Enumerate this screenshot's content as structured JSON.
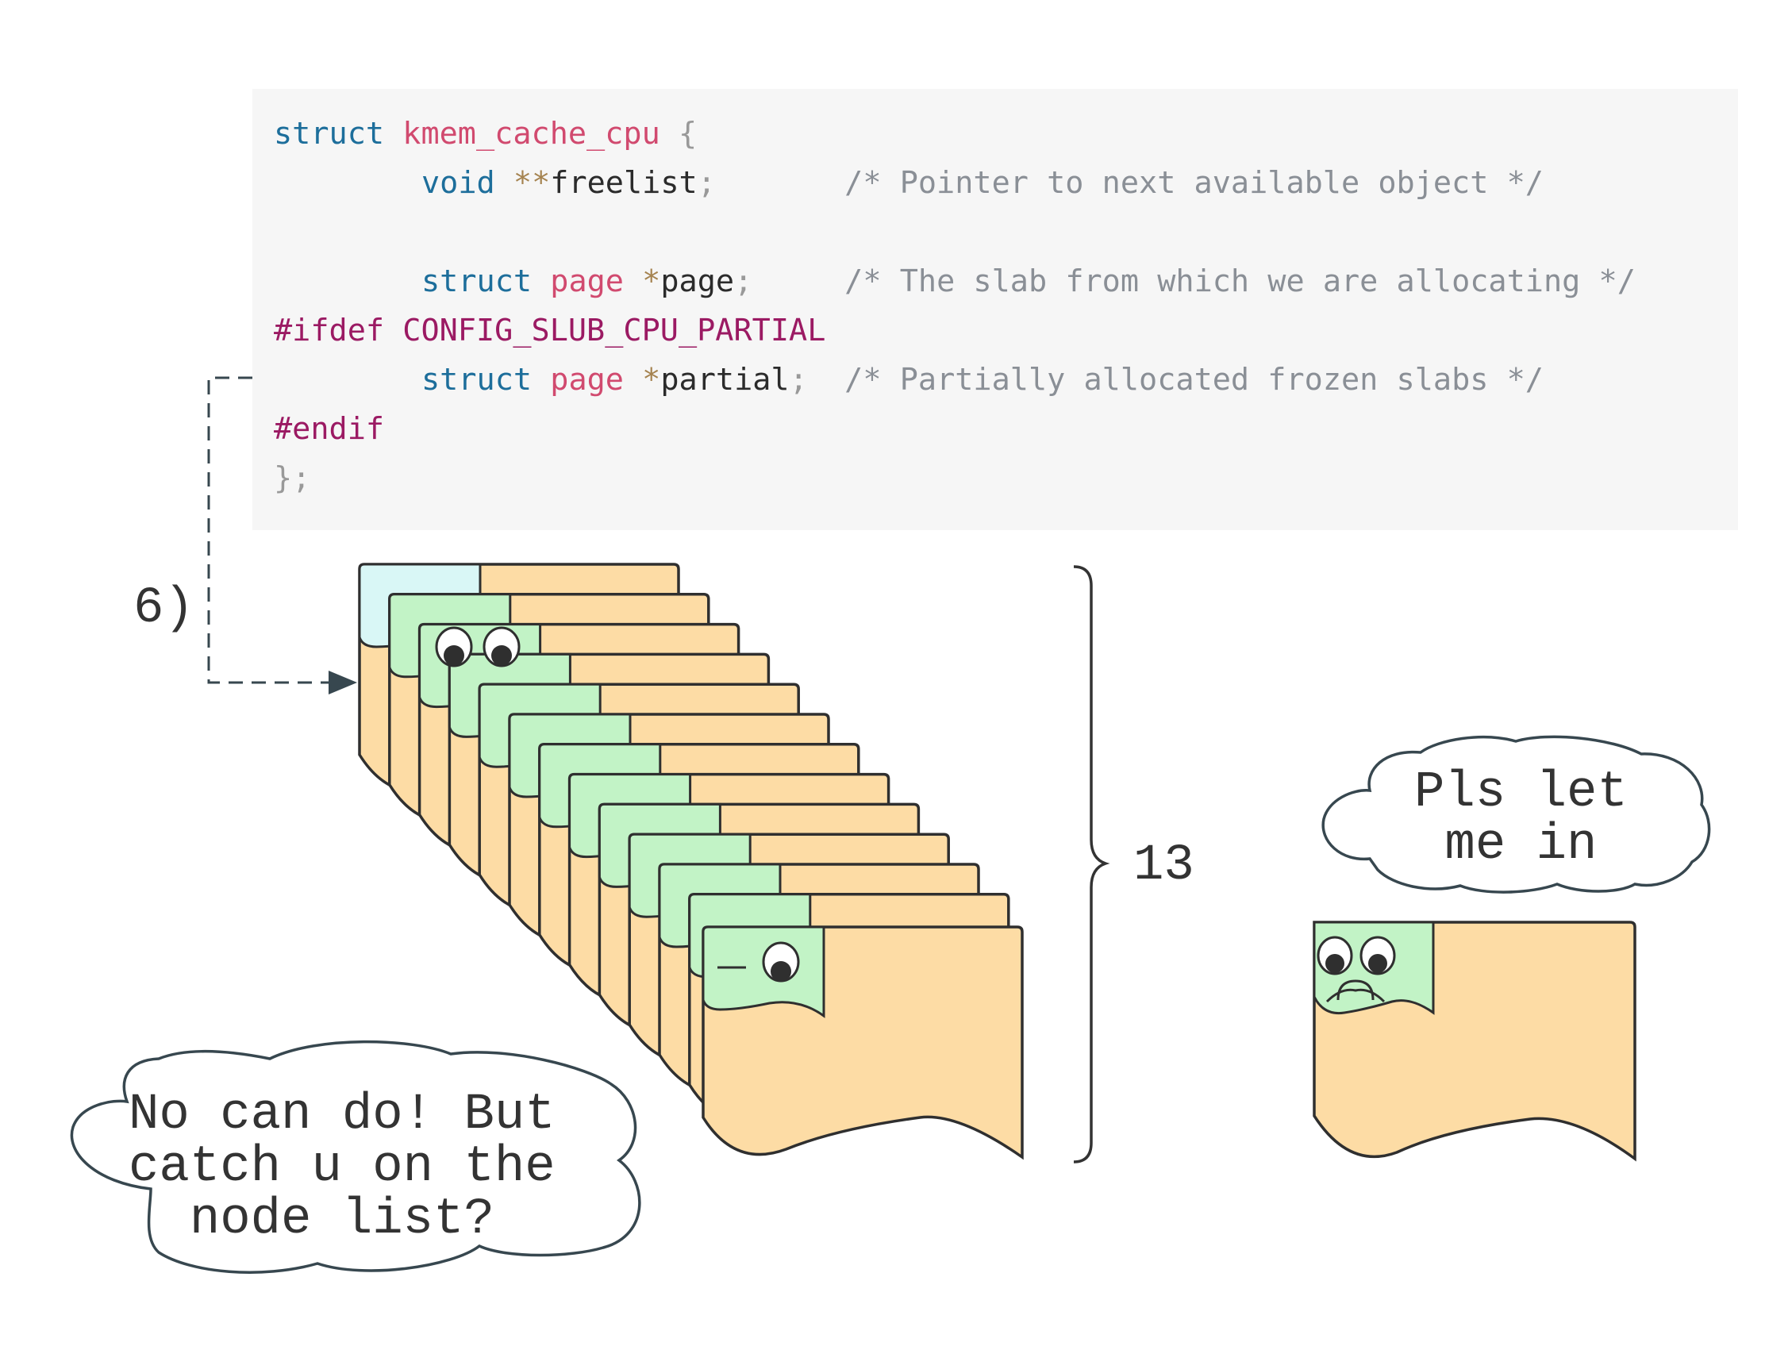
{
  "code": {
    "struct_keyword": "struct",
    "struct_name": "kmem_cache_cpu",
    "open_brace": "{",
    "line_freelist": {
      "type": "void",
      "ptr": "**",
      "name": "freelist",
      "semi": ";",
      "comment": "/* Pointer to next available object */"
    },
    "line_page": {
      "kw": "struct",
      "type": "page",
      "ptr": "*",
      "name": "page",
      "semi": ";",
      "comment": "/* The slab from which we are allocating */"
    },
    "ifdef": "#ifdef",
    "config": "CONFIG_SLUB_CPU_PARTIAL",
    "line_partial": {
      "kw": "struct",
      "type": "page",
      "ptr": "*",
      "name": "partial",
      "semi": ";",
      "comment": "/* Partially allocated frozen slabs */"
    },
    "endif": "#endif",
    "close": "};"
  },
  "labels": {
    "step": "6)",
    "count": "13"
  },
  "bubbles": {
    "left_text": "No can do! But\ncatch u on the\n  node list?",
    "right_text": "Pls let\n me in"
  },
  "colors": {
    "code_bg": "#f6f6f6",
    "page_body": "#fddca5",
    "page_head": "#c2f3c6",
    "first_head": "#d9f7f6",
    "outline": "#2f2f2f"
  }
}
